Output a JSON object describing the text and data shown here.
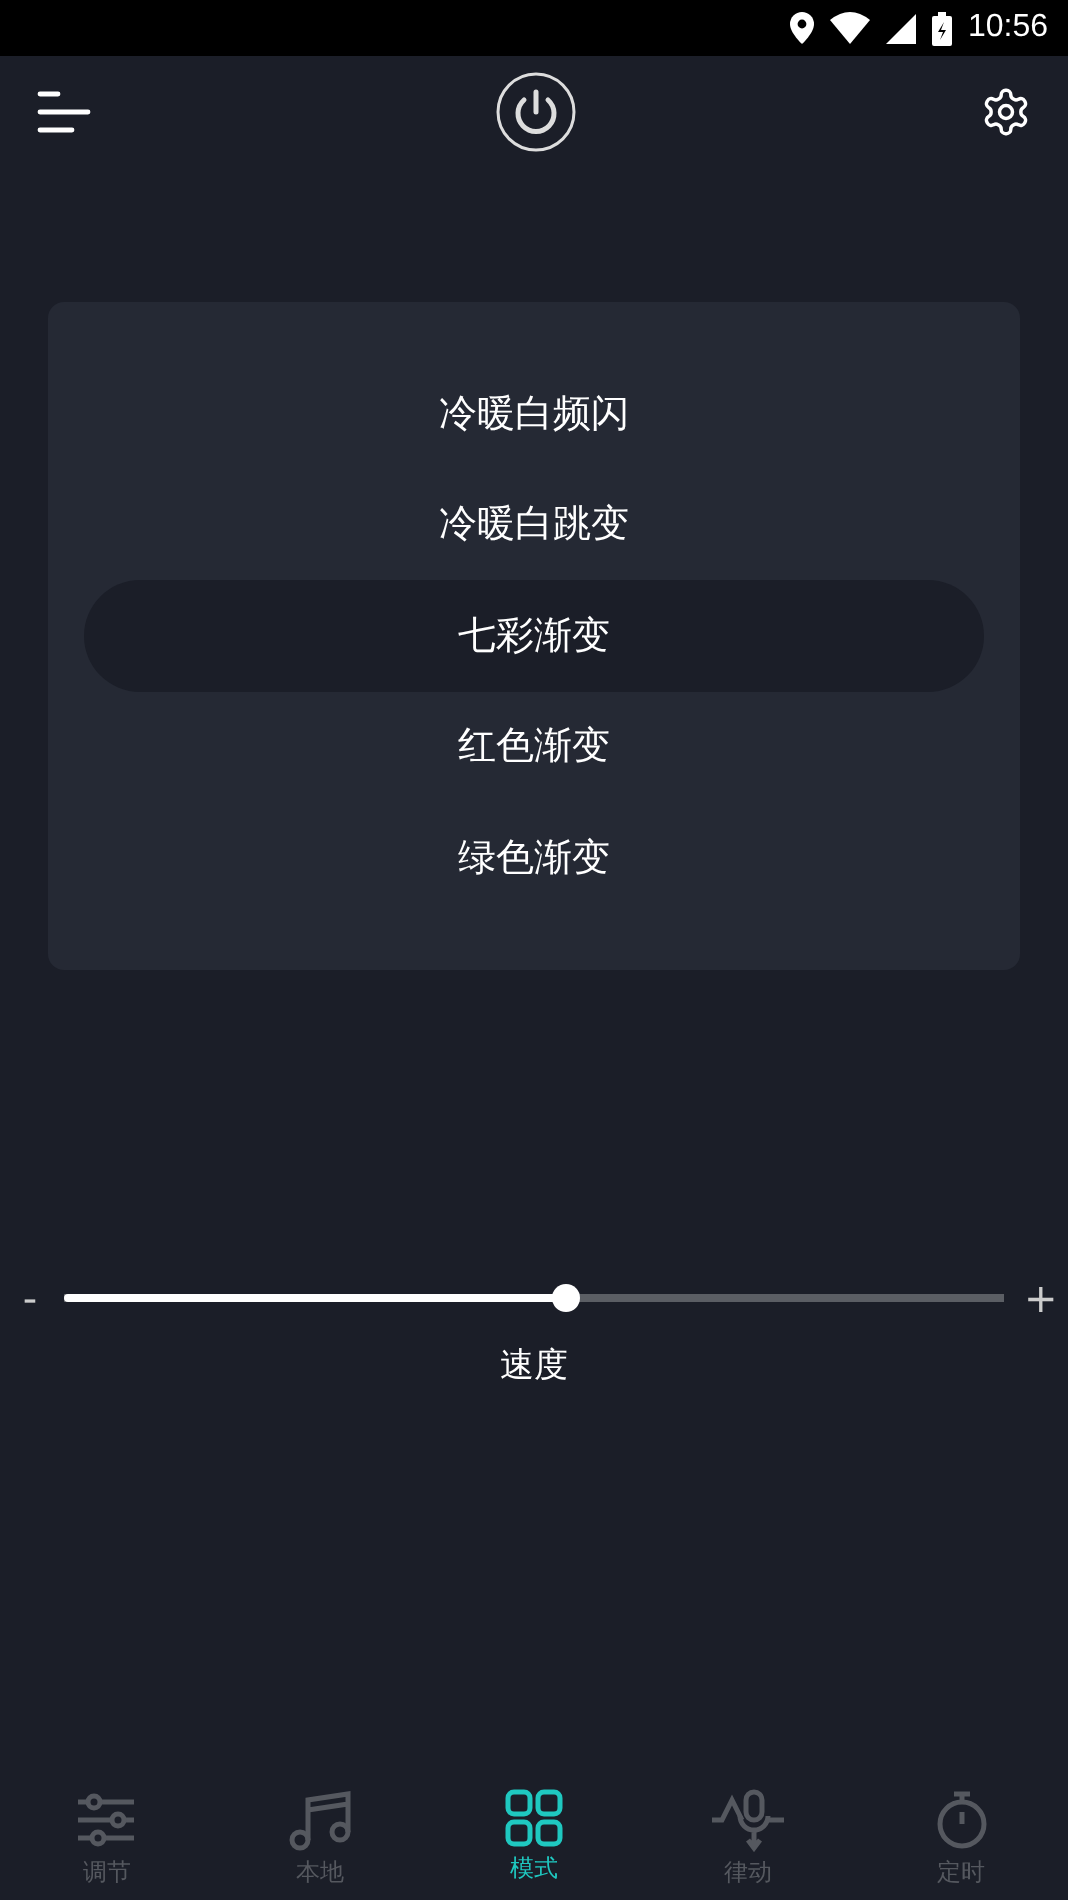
{
  "status_bar": {
    "time": "10:56"
  },
  "modes": [
    {
      "label": "冷暖白频闪",
      "selected": false
    },
    {
      "label": "冷暖白跳变",
      "selected": false
    },
    {
      "label": "七彩渐变",
      "selected": true
    },
    {
      "label": "红色渐变",
      "selected": false
    },
    {
      "label": "绿色渐变",
      "selected": false
    }
  ],
  "speed": {
    "minus": "-",
    "plus": "+",
    "level": 0.535,
    "label": "速度"
  },
  "tabs": [
    {
      "label": "调节",
      "kind": "sliders",
      "selected": false
    },
    {
      "label": "本地",
      "kind": "music",
      "selected": false
    },
    {
      "label": "模式",
      "kind": "grid",
      "selected": true
    },
    {
      "label": "律动",
      "kind": "mic",
      "selected": false
    },
    {
      "label": "定时",
      "kind": "timer",
      "selected": false
    }
  ]
}
